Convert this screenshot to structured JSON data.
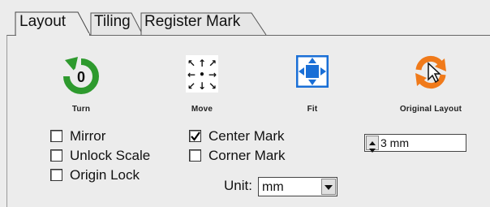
{
  "tabs": [
    {
      "label": "Layout",
      "active": true
    },
    {
      "label": "Tiling",
      "active": false
    },
    {
      "label": "Register Mark",
      "active": false
    }
  ],
  "tools": {
    "turn": {
      "label": "Turn",
      "value": "0",
      "icon": "rotate-icon",
      "color": "#2e9a2e"
    },
    "move": {
      "label": "Move",
      "icon": "move-arrows-icon"
    },
    "fit": {
      "label": "Fit",
      "icon": "fit-to-page-icon",
      "color": "#1a6fd6"
    },
    "original_layout": {
      "label": "Original Layout",
      "icon": "reset-cursor-icon",
      "color": "#f07a1a"
    }
  },
  "checkboxes": {
    "mirror": {
      "label": "Mirror",
      "checked": false
    },
    "unlock_scale": {
      "label": "Unlock Scale",
      "checked": false
    },
    "origin_lock": {
      "label": "Origin Lock",
      "checked": false
    },
    "center_mark": {
      "label": "Center Mark",
      "checked": true
    },
    "corner_mark": {
      "label": "Corner Mark",
      "checked": false
    }
  },
  "mark_size": {
    "value": "3 mm"
  },
  "unit": {
    "label": "Unit:",
    "value": "mm"
  }
}
